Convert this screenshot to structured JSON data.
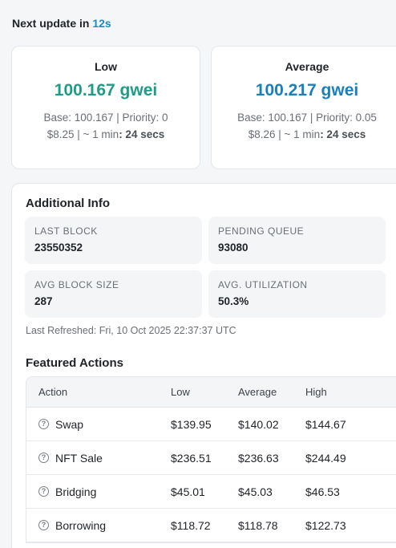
{
  "header": {
    "prefix": "Next update in",
    "countdown": "12s"
  },
  "cards": {
    "low": {
      "title": "Low",
      "price": "100.167 gwei",
      "base_priority": "Base: 100.167 | Priority: 0",
      "cost_prefix": "$8.25 | ~ 1 min",
      "cost_suffix": ": 24 secs"
    },
    "average": {
      "title": "Average",
      "price": "100.217 gwei",
      "base_priority": "Base: 100.167 | Priority: 0.05",
      "cost_prefix": "$8.26 | ~ 1 min",
      "cost_suffix": ": 24 secs"
    }
  },
  "additional_info": {
    "title": "Additional Info",
    "last_block": {
      "label": "LAST BLOCK",
      "value": "23550352"
    },
    "pending_queue": {
      "label": "PENDING QUEUE",
      "value": "93080"
    },
    "avg_block_size": {
      "label": "AVG BLOCK SIZE",
      "value": "287"
    },
    "avg_utilization": {
      "label": "AVG. UTILIZATION",
      "value": "50.3%"
    },
    "last_refreshed": "Last Refreshed: Fri, 10 Oct 2025 22:37:37 UTC"
  },
  "featured": {
    "title": "Featured Actions",
    "columns": [
      "Action",
      "Low",
      "Average",
      "High"
    ],
    "rows": [
      {
        "action": "Swap",
        "low": "$139.95",
        "average": "$140.02",
        "high": "$144.67"
      },
      {
        "action": "NFT Sale",
        "low": "$236.51",
        "average": "$236.63",
        "high": "$244.49"
      },
      {
        "action": "Bridging",
        "low": "$45.01",
        "average": "$45.03",
        "high": "$46.53"
      },
      {
        "action": "Borrowing",
        "low": "$118.72",
        "average": "$118.78",
        "high": "$122.73"
      }
    ]
  }
}
